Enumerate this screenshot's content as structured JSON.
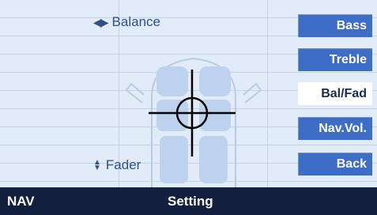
{
  "labels": {
    "balance": "Balance",
    "fader": "Fader"
  },
  "menu": {
    "items": [
      {
        "label": "Bass",
        "active": false
      },
      {
        "label": "Treble",
        "active": false
      },
      {
        "label": "Bal/Fad",
        "active": true
      },
      {
        "label": "Nav.Vol.",
        "active": false
      },
      {
        "label": "Back",
        "active": false
      }
    ]
  },
  "status": {
    "left": "NAV",
    "center": "Setting"
  },
  "colors": {
    "button": "#3e6dc6",
    "button_active_bg": "#ffffff",
    "status_bar": "#13203d",
    "background": "#e2ebf8",
    "text": "#2f4f86"
  },
  "icons": {
    "balance": "left-right-arrows-icon",
    "fader": "up-down-arrows-icon",
    "position": "crosshair-icon",
    "car": "car-top-view-icon"
  }
}
